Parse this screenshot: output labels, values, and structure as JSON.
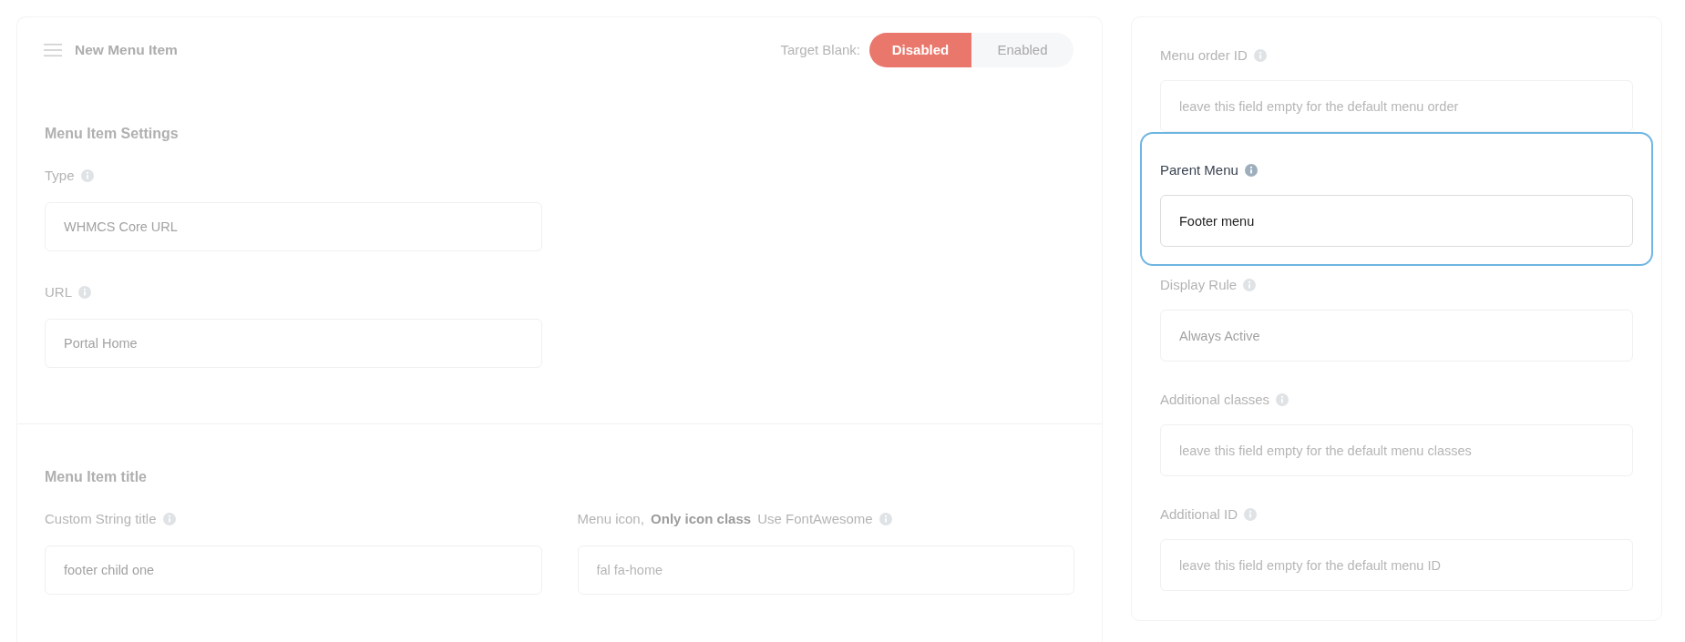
{
  "header": {
    "title": "New Menu Item",
    "target_blank": {
      "label": "Target Blank:",
      "options": [
        {
          "label": "Disabled",
          "selected": true
        },
        {
          "label": "Enabled",
          "selected": false
        }
      ]
    }
  },
  "settings_section": {
    "title": "Menu Item Settings",
    "fields": [
      {
        "label": "Type",
        "value": "WHMCS Core URL",
        "highlighted": false
      },
      {
        "label": "URL",
        "value": "Portal Home",
        "highlighted": false
      }
    ]
  },
  "title_section": {
    "title": "Menu Item title",
    "fields": [
      {
        "label": "Custom String title",
        "value": "footer child one",
        "highlighted": false
      },
      {
        "label": "Menu icon, **Only icon class** Use FontAwesome",
        "placeholder": "fal fa-home",
        "highlighted": false
      }
    ]
  },
  "sidebar": {
    "fields": [
      {
        "label": "Menu order ID",
        "placeholder": "leave this field empty for the default menu order",
        "highlighted": false
      },
      {
        "label": "Parent Menu",
        "value": "Footer menu",
        "highlighted": true
      },
      {
        "label": "Display Rule",
        "value": "Always Active",
        "highlighted": false
      },
      {
        "label": "Additional classes",
        "placeholder": "leave this field empty for the default menu classes",
        "highlighted": false
      },
      {
        "label": "Additional ID",
        "placeholder": "leave this field empty for the default menu ID",
        "highlighted": false
      }
    ]
  }
}
